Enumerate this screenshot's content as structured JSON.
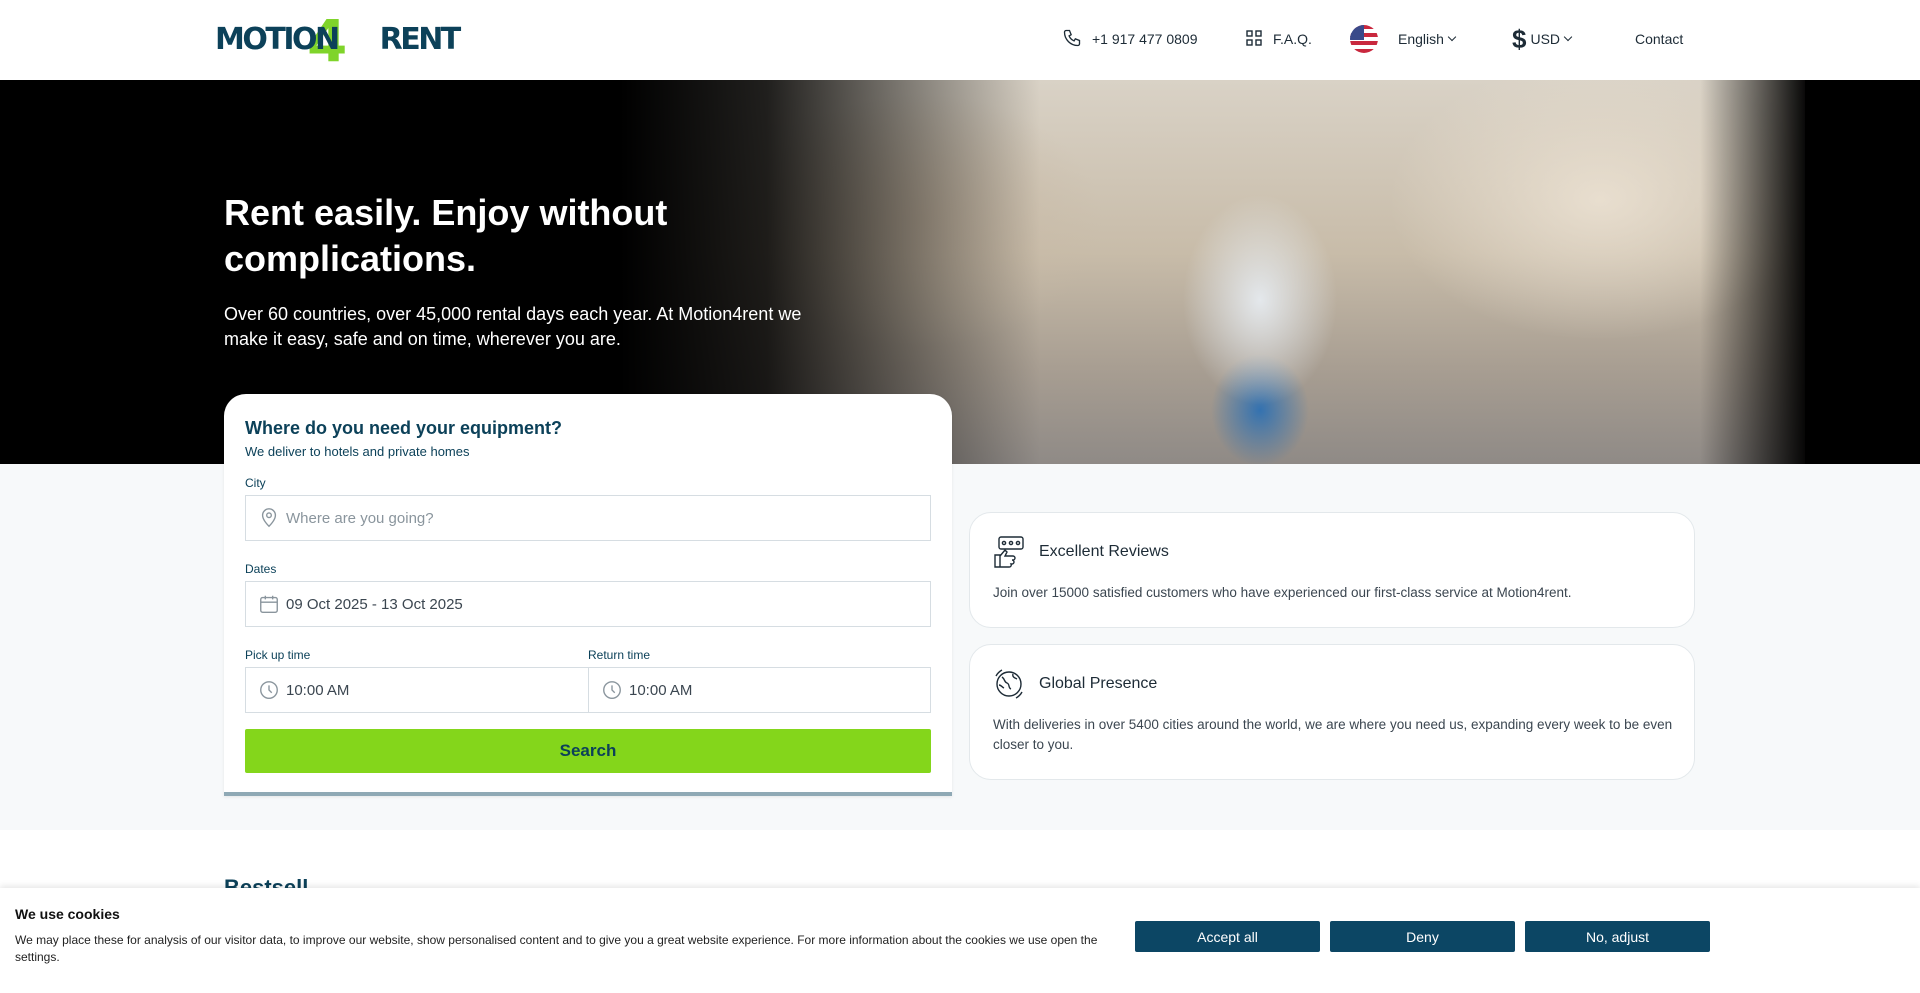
{
  "header": {
    "logo_text": "MOTION4RENT",
    "logo_left": "MOTION",
    "logo_digit": "4",
    "logo_right": "RENT",
    "phone": "+1 917 477 0809",
    "faq": "F.A.Q.",
    "language": "English",
    "currency": "USD",
    "contact": "Contact"
  },
  "hero": {
    "title": "Rent easily. Enjoy without complications.",
    "subtitle": "Over 60 countries, over 45,000 rental days each year. At Motion4rent we make it easy, safe and on time, wherever you are."
  },
  "search": {
    "title": "Where do you need your equipment?",
    "subtitle": "We deliver to hotels and private homes",
    "city_label": "City",
    "city_placeholder": "Where are you going?",
    "dates_label": "Dates",
    "dates_value": "09 Oct 2025 - 13 Oct 2025",
    "pickup_label": "Pick up time",
    "pickup_value": "10:00 AM",
    "return_label": "Return time",
    "return_value": "10:00 AM",
    "button": "Search"
  },
  "features": [
    {
      "title": "Excellent Reviews",
      "text": "Join over 15000 satisfied customers who have experienced our first-class service at Motion4rent.",
      "icon": "reviews-icon"
    },
    {
      "title": "Global Presence",
      "text": "With deliveries in over 5400 cities around the world, we are where you need us, expanding every week to be even closer to you.",
      "icon": "globe-icon"
    }
  ],
  "next_section": {
    "heading_partial": "Bestsell"
  },
  "cookie": {
    "title": "We use cookies",
    "text": "We may place these for analysis of our visitor data, to improve our website, show personalised content and to give you a great website experience. For more information about the cookies we use open the settings.",
    "accept": "Accept all",
    "deny": "Deny",
    "adjust": "No, adjust"
  },
  "colors": {
    "brand_dark": "#0c4159",
    "brand_green": "#84d61b",
    "cookie_button": "#0c4664"
  }
}
